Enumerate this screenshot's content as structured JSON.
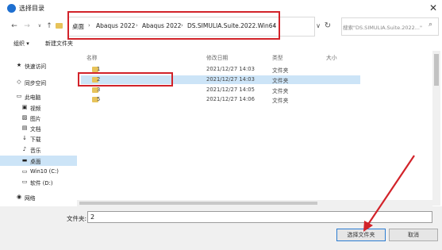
{
  "window": {
    "title": "选择目录",
    "close_glyph": "✕"
  },
  "nav": {
    "back": "←",
    "forward": "→",
    "up_dropdown": "∨",
    "up": "↑",
    "address_dropdown": "∨",
    "refresh": "↻",
    "breadcrumbs": [
      "桌面",
      "Abaqus 2022",
      "Abaqus 2022",
      "DS.SIMULIA.Suite.2022.Win64"
    ],
    "separator": "›",
    "search_placeholder": "搜索\"DS.SIMULIA.Suite.2022...\"",
    "search_glyph": "⌕"
  },
  "toolbar": {
    "organize": "组织 ▾",
    "new_folder": "新建文件夹"
  },
  "sidebar": {
    "items": [
      {
        "label": "快速访问",
        "icon": "★",
        "level": 1
      },
      {
        "label": "同步空间",
        "icon": "◇",
        "level": 1
      },
      {
        "label": "此电脑",
        "icon": "▭",
        "level": 1
      },
      {
        "label": "视频",
        "icon": "▣",
        "level": 2
      },
      {
        "label": "图片",
        "icon": "▨",
        "level": 2
      },
      {
        "label": "文档",
        "icon": "▤",
        "level": 2
      },
      {
        "label": "下载",
        "icon": "↓",
        "level": 2
      },
      {
        "label": "音乐",
        "icon": "♪",
        "level": 2
      },
      {
        "label": "桌面",
        "icon": "▬",
        "level": 2,
        "selected": true
      },
      {
        "label": "Win10 (C:)",
        "icon": "▭",
        "level": 2
      },
      {
        "label": "软件 (D:)",
        "icon": "▭",
        "level": 2
      },
      {
        "label": "网络",
        "icon": "◉",
        "level": 1
      }
    ]
  },
  "columns": {
    "name": "名称",
    "date": "修改日期",
    "type": "类型",
    "size": "大小"
  },
  "files": [
    {
      "name": "1",
      "date": "2021/12/27 14:03",
      "type": "文件夹"
    },
    {
      "name": "2",
      "date": "2021/12/27 14:03",
      "type": "文件夹",
      "selected": true
    },
    {
      "name": "3",
      "date": "2021/12/27 14:05",
      "type": "文件夹"
    },
    {
      "name": "5",
      "date": "2021/12/27 14:06",
      "type": "文件夹"
    }
  ],
  "footer": {
    "folder_label": "文件夹:",
    "folder_value": "2",
    "ok_label": "选择文件夹",
    "cancel_label": "取消"
  },
  "colors": {
    "highlight_red": "#d2232a",
    "selection_blue": "#cce4f7",
    "folder_yellow": "#e7c35a"
  }
}
